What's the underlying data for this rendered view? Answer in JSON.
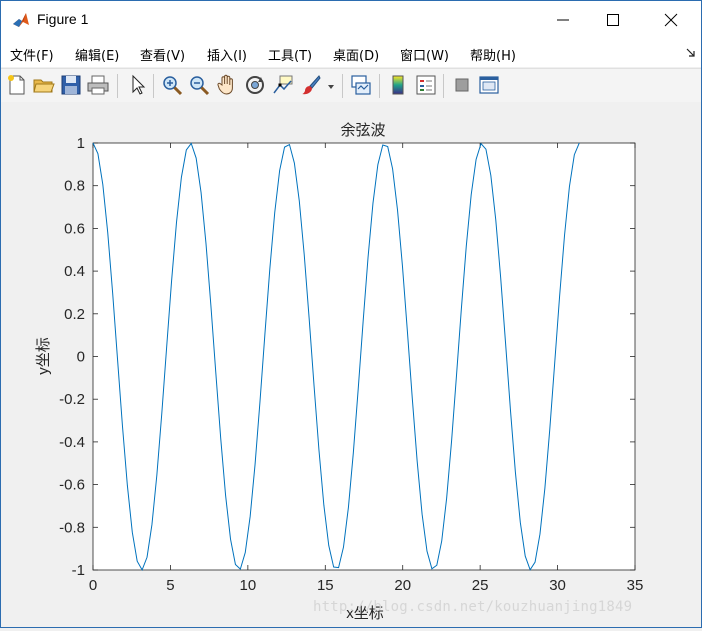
{
  "window": {
    "title": "Figure 1",
    "controls": {
      "minimize": "minimize",
      "maximize": "maximize",
      "close": "close"
    }
  },
  "menu": [
    "文件(F)",
    "编辑(E)",
    "查看(V)",
    "插入(I)",
    "工具(T)",
    "桌面(D)",
    "窗口(W)",
    "帮助(H)"
  ],
  "toolbar": [
    "new-figure-icon",
    "open-file-icon",
    "save-icon",
    "print-icon",
    "edit-plot-pointer-icon",
    "zoom-in-icon",
    "zoom-out-icon",
    "pan-hand-icon",
    "rotate-3d-icon",
    "data-cursor-icon",
    "brush-icon",
    "link-plot-icon",
    "insert-colorbar-icon",
    "insert-legend-icon",
    "hide-plot-tools-icon",
    "show-plot-tools-icon"
  ],
  "chart_data": {
    "type": "line",
    "title": "余弦波",
    "xlabel": "x坐标",
    "ylabel": "y坐标",
    "xlim": [
      0,
      35
    ],
    "ylim": [
      -1,
      1
    ],
    "xticks": [
      "0",
      "5",
      "10",
      "15",
      "20",
      "25",
      "30",
      "35"
    ],
    "yticks": [
      "1",
      "0.8",
      "0.6",
      "0.4",
      "0.2",
      "0",
      "-0.2",
      "-0.4",
      "-0.6",
      "-0.8",
      "-1"
    ],
    "grid": false,
    "line_color": "#0072bd",
    "series": [
      {
        "function": "cos(x)",
        "x_range": [
          0,
          31.4
        ],
        "samples": 100
      }
    ]
  },
  "watermark": "http://blog.csdn.net/kouzhuanjing1849"
}
